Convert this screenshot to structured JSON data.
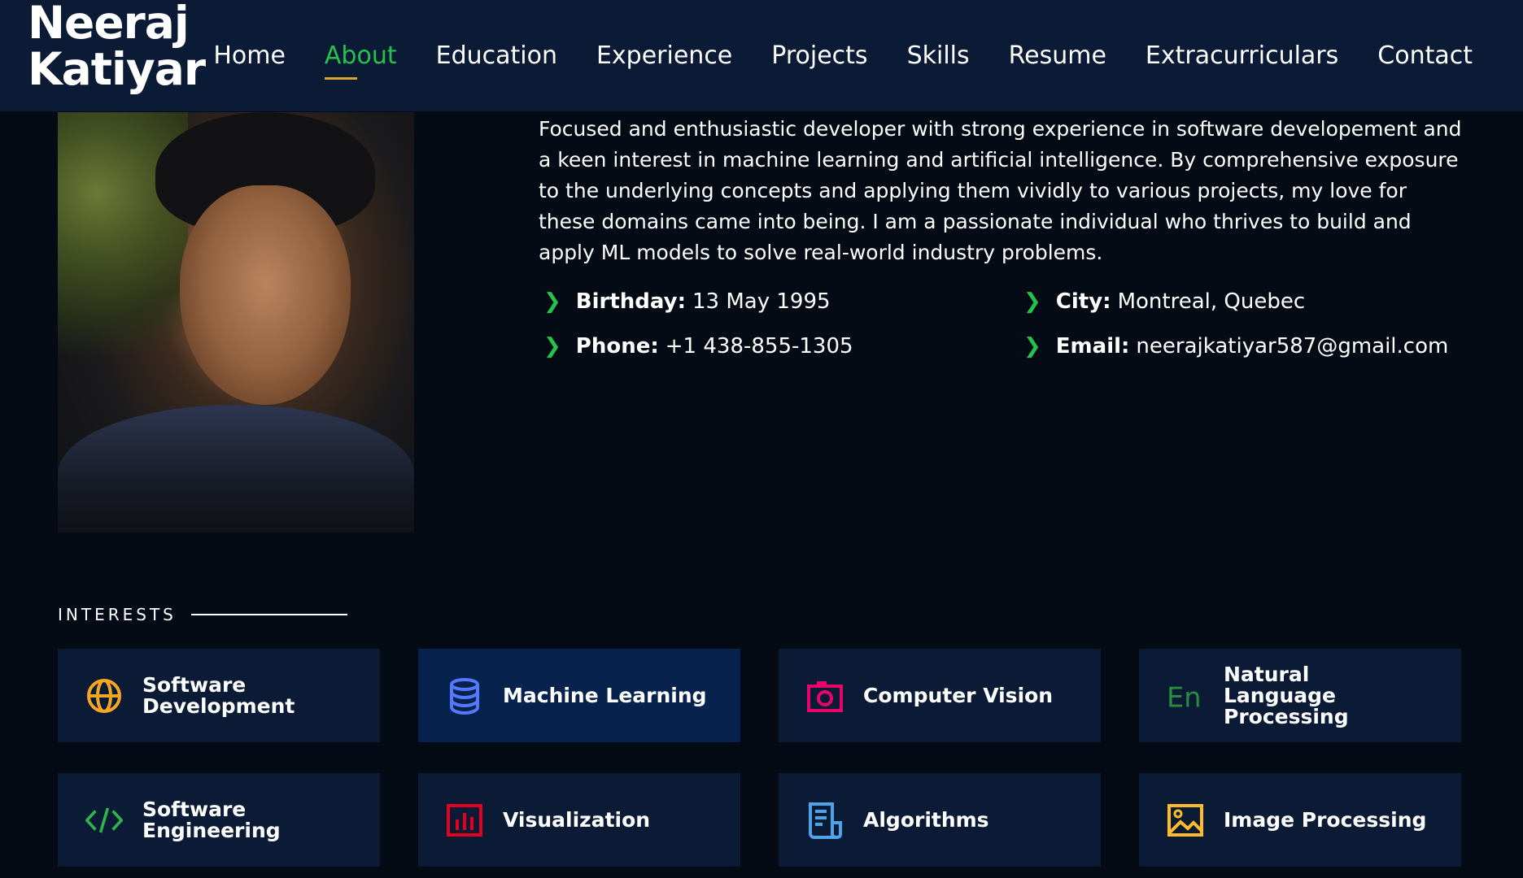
{
  "header": {
    "logo_line1": "Neeraj",
    "logo_line2": "Katiyar",
    "nav": [
      "Home",
      "About",
      "Education",
      "Experience",
      "Projects",
      "Skills",
      "Resume",
      "Extracurriculars",
      "Contact"
    ],
    "active": "About"
  },
  "about": {
    "bio": "Focused and enthusiastic developer with strong experience in software developement and a keen interest in machine learning and artificial intelligence. By comprehensive exposure to the underlying concepts and applying them vividly to various projects, my love for these domains came into being. I am a passionate individual who thrives to build and apply ML models to solve real-world industry problems.",
    "birthday_label": "Birthday:",
    "birthday": "13 May 1995",
    "city_label": "City:",
    "city": "Montreal, Quebec",
    "phone_label": "Phone:",
    "phone": "+1 438-855-1305",
    "email_label": "Email:",
    "email": "neerajkatiyar587@gmail.com"
  },
  "interests": {
    "title": "INTERESTS",
    "items": [
      {
        "label": "Software Development",
        "icon": "globe-icon",
        "color": "#f5a623"
      },
      {
        "label": "Machine Learning",
        "icon": "database-icon",
        "color": "#5578ff"
      },
      {
        "label": "Computer Vision",
        "icon": "camera-icon",
        "color": "#e80368"
      },
      {
        "label": "Natural Language Processing",
        "icon": "en-language-icon",
        "color": "#2a8c3e"
      },
      {
        "label": "Software Engineering",
        "icon": "code-icon",
        "color": "#2fb64a"
      },
      {
        "label": "Visualization",
        "icon": "bar-chart-icon",
        "color": "#e1001e"
      },
      {
        "label": "Algorithms",
        "icon": "document-icon",
        "color": "#4fa3e8"
      },
      {
        "label": "Image Processing",
        "icon": "image-icon",
        "color": "#ffbb2c"
      }
    ]
  }
}
